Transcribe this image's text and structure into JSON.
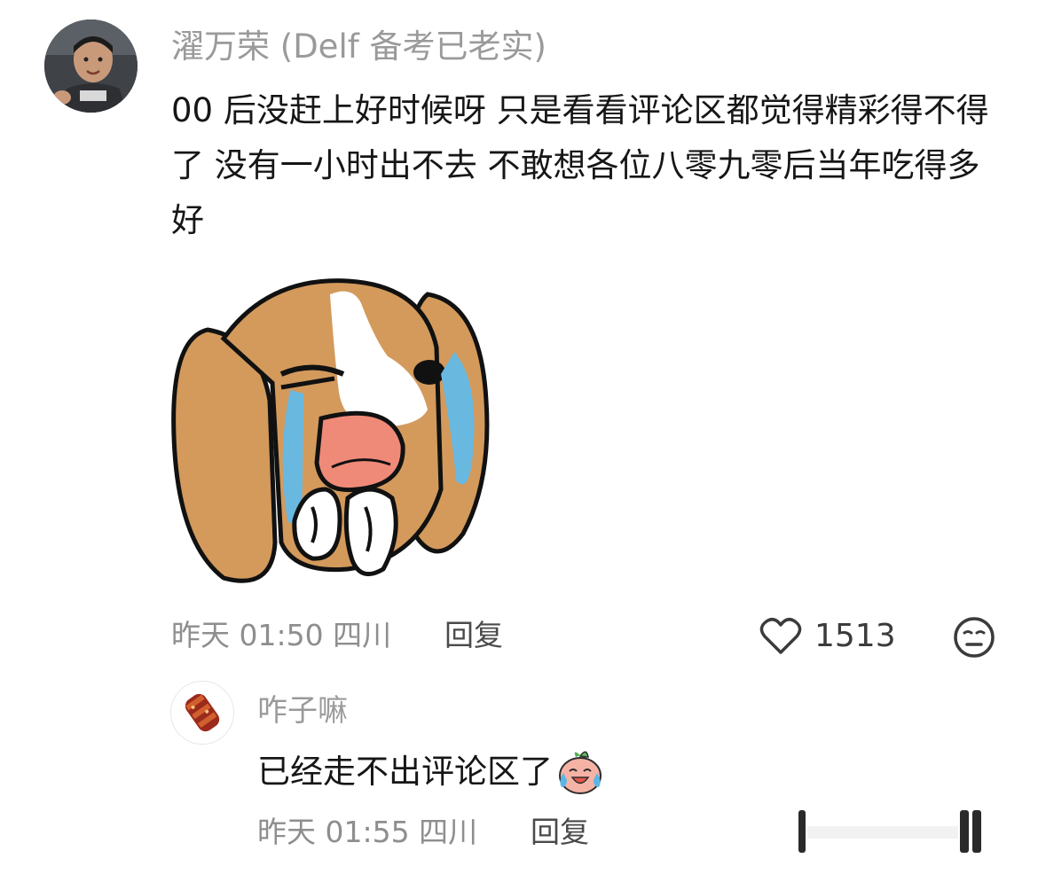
{
  "main_comment": {
    "username": "濯万荣 (Delf 备考已老实)",
    "text": "00 后没赶上好时候呀 只是看看评论区都觉得精彩得不得了 没有一小时出不去 不敢想各位八零九零后当年吃得多好",
    "sticker": "crying-dog-sticker",
    "time": "昨天 01:50",
    "location": "四川",
    "reply_label": "回复",
    "like_count": "1513",
    "like_icon": "heart-outline-icon",
    "reaction_icon": "neutral-face-icon"
  },
  "reply_comment": {
    "username": "咋子嘛",
    "text": "已经走不出评论区了",
    "emoji": "crying-laughing-peach-emoji",
    "time": "昨天 01:55",
    "location": "四川",
    "reply_label": "回复"
  },
  "colors": {
    "muted_text": "#9a9a9a",
    "body_text": "#161616",
    "dog_fur": "#d39a5c",
    "tear_blue": "#69b8e0"
  }
}
